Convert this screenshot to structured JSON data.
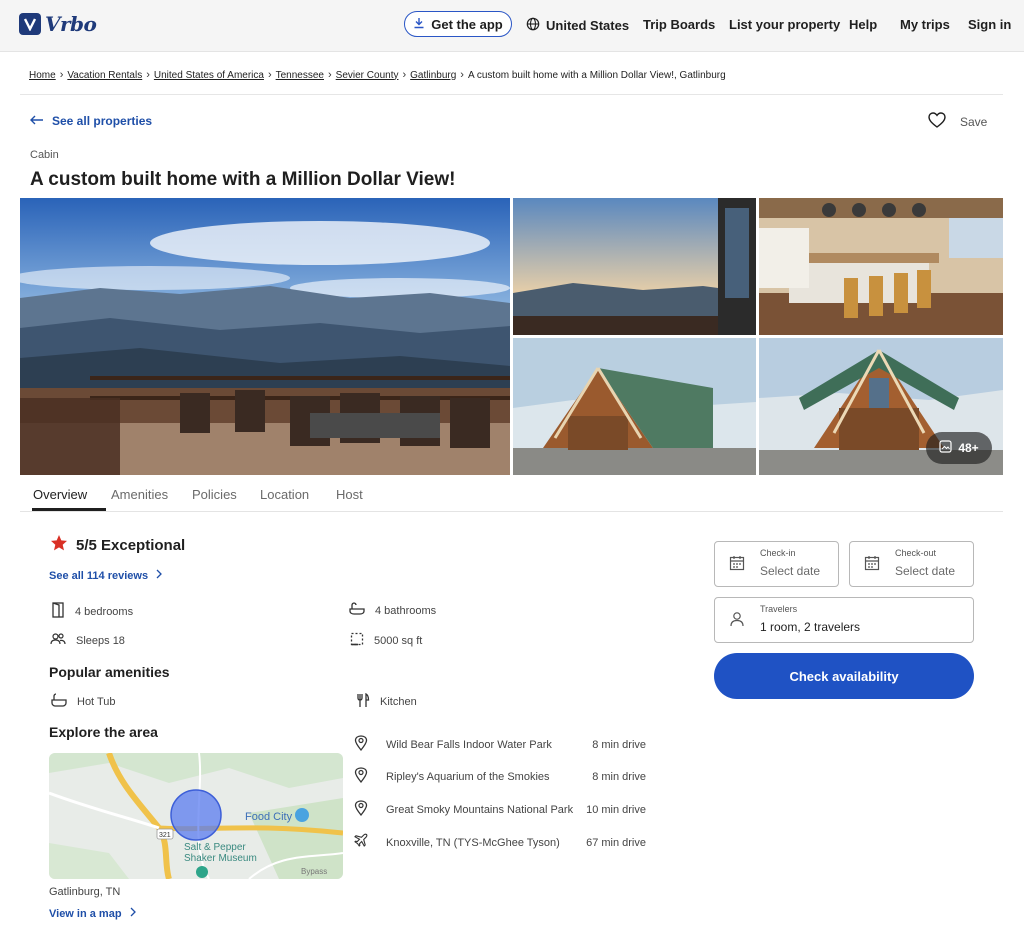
{
  "header": {
    "logo_text": "Vrbo",
    "get_app": "Get the app",
    "region": "United States",
    "nav": [
      "Trip Boards",
      "List your property",
      "Help",
      "My trips",
      "Sign in"
    ]
  },
  "breadcrumb": [
    "Home",
    "Vacation Rentals",
    "United States of America",
    "Tennessee",
    "Sevier County",
    "Gatlinburg"
  ],
  "breadcrumb_current": "A custom built home with a Million Dollar View!, Gatlinburg",
  "see_all_properties": "See all properties",
  "save_label": "Save",
  "property": {
    "type": "Cabin",
    "title": "A custom built home with a Million Dollar View!"
  },
  "gallery": {
    "more_count": "48+"
  },
  "tabs": [
    "Overview",
    "Amenities",
    "Policies",
    "Location",
    "Host"
  ],
  "rating": {
    "score": "5/5 Exceptional",
    "reviews_link": "See all 114 reviews"
  },
  "facts": {
    "bedrooms": "4 bedrooms",
    "bathrooms": "4 bathrooms",
    "sleeps": "Sleeps 18",
    "area": "5000 sq ft"
  },
  "amenities": {
    "heading": "Popular amenities",
    "items": [
      "Hot Tub",
      "Kitchen"
    ]
  },
  "explore": {
    "heading": "Explore the area",
    "map_labels": {
      "food_city": "Food City",
      "museum_line1": "Salt & Pepper",
      "museum_line2": "Shaker Museum",
      "route": "321",
      "bypass": "Bypass"
    },
    "location": "Gatlinburg, TN",
    "view_map": "View in a map",
    "places": [
      {
        "name": "Wild Bear Falls Indoor Water Park",
        "distance": "8 min drive",
        "icon": "pin"
      },
      {
        "name": "Ripley's Aquarium of the Smokies",
        "distance": "8 min drive",
        "icon": "pin"
      },
      {
        "name": "Great Smoky Mountains National Park",
        "distance": "10 min drive",
        "icon": "pin"
      },
      {
        "name": "Knoxville, TN (TYS-McGhee Tyson)",
        "distance": "67 min drive",
        "icon": "plane"
      }
    ]
  },
  "booking": {
    "checkin_label": "Check-in",
    "checkin_placeholder": "Select date",
    "checkout_label": "Check-out",
    "checkout_placeholder": "Select date",
    "travelers_label": "Travelers",
    "travelers_value": "1 room, 2 travelers",
    "check_button": "Check availability"
  },
  "colors": {
    "brand": "#1f3a7a",
    "accent": "#1f52c4",
    "link": "#1f4fa8",
    "star": "#d93025"
  }
}
